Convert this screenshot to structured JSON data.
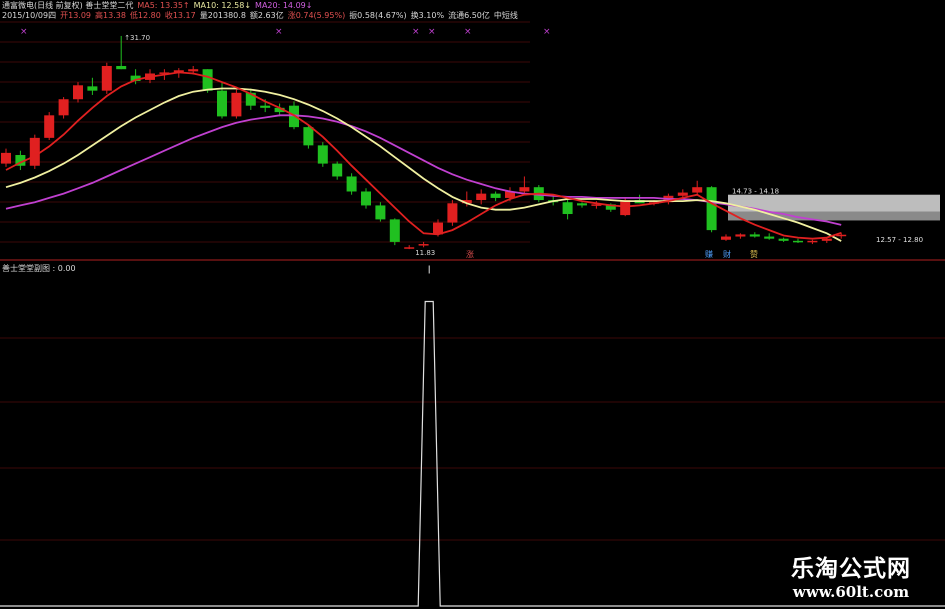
{
  "header": {
    "line1": [
      {
        "text": "通富微电(日线 前复权) 善士堂堂二代",
        "color": "#d8d8d8"
      },
      {
        "text": "MA5: 13.35↑",
        "color": "#e05050"
      },
      {
        "text": "MA10: 12.58↓",
        "color": "#e8e8a0"
      },
      {
        "text": "MA20: 14.09↓",
        "color": "#d060e0"
      }
    ],
    "line2": [
      {
        "text": "2015/10/09四",
        "color": "#d8d8d8"
      },
      {
        "text": "开13.09",
        "color": "#e05050"
      },
      {
        "text": "高13.38",
        "color": "#e05050"
      },
      {
        "text": "低12.80",
        "color": "#e05050"
      },
      {
        "text": "收13.17",
        "color": "#e05050"
      },
      {
        "text": "量201380.8",
        "color": "#d8d8d8"
      },
      {
        "text": "额2.63亿",
        "color": "#d8d8d8"
      },
      {
        "text": "涨0.74(5.95%)",
        "color": "#e05050"
      },
      {
        "text": "振0.58(4.67%)",
        "color": "#d8d8d8"
      },
      {
        "text": "换3.10%",
        "color": "#d8d8d8"
      },
      {
        "text": "流通6.50亿",
        "color": "#d8d8d8"
      },
      {
        "text": "中短线",
        "color": "#d8d8d8"
      }
    ]
  },
  "main": {
    "high_label": "31.70",
    "low_label": "11.83",
    "band_label_upper": "14.73 - 14.18",
    "band_label_lower": "12.57 - 12.80",
    "tags": [
      {
        "text": "涨",
        "color": "#e05050"
      },
      {
        "text": "赚",
        "color": "#50a0ff"
      },
      {
        "text": "财",
        "color": "#50a0ff"
      },
      {
        "text": "赞",
        "color": "#e0c050"
      }
    ],
    "colors": {
      "up": "#e02020",
      "down": "#20c020",
      "ma5": "#e02020",
      "ma10": "#f0f0a0",
      "ma20": "#c040d0",
      "grid": "#7a1010"
    }
  },
  "sub": {
    "title": "善士堂堂副图 : 0.00",
    "line_color": "#e0e0e0"
  },
  "watermark": {
    "title": "乐淘公式网",
    "url": "www.60lt.com"
  },
  "chart_data": {
    "type": "candlestick",
    "candles": [
      [
        19.8,
        21.2,
        19.5,
        20.8
      ],
      [
        20.6,
        21.0,
        19.2,
        19.6
      ],
      [
        19.6,
        22.5,
        19.3,
        22.2
      ],
      [
        22.2,
        24.6,
        22.0,
        24.3
      ],
      [
        24.3,
        26.0,
        24.0,
        25.8
      ],
      [
        25.8,
        27.4,
        25.5,
        27.1
      ],
      [
        27.0,
        27.8,
        26.2,
        26.6
      ],
      [
        26.6,
        29.2,
        26.3,
        28.9
      ],
      [
        28.9,
        31.7,
        28.6,
        28.6
      ],
      [
        28.0,
        28.6,
        27.2,
        27.5
      ],
      [
        27.6,
        28.6,
        27.3,
        28.2
      ],
      [
        28.2,
        28.6,
        27.6,
        28.3
      ],
      [
        28.3,
        28.7,
        27.8,
        28.5
      ],
      [
        28.4,
        28.9,
        28.1,
        28.6
      ],
      [
        28.6,
        28.6,
        26.4,
        26.6
      ],
      [
        26.6,
        27.4,
        24.0,
        24.2
      ],
      [
        24.2,
        26.7,
        24.0,
        26.4
      ],
      [
        26.4,
        26.8,
        24.8,
        25.2
      ],
      [
        25.2,
        25.8,
        24.6,
        25.0
      ],
      [
        25.0,
        25.4,
        24.2,
        24.6
      ],
      [
        25.2,
        25.6,
        23.0,
        23.2
      ],
      [
        23.2,
        23.4,
        21.2,
        21.5
      ],
      [
        21.5,
        21.8,
        19.5,
        19.8
      ],
      [
        19.8,
        20.0,
        18.3,
        18.6
      ],
      [
        18.6,
        18.9,
        16.9,
        17.2
      ],
      [
        17.2,
        17.5,
        15.6,
        15.9
      ],
      [
        15.9,
        16.2,
        14.4,
        14.6
      ],
      [
        14.6,
        14.7,
        12.2,
        12.5
      ],
      [
        12.0,
        12.2,
        11.83,
        12.0
      ],
      [
        12.2,
        12.5,
        12.0,
        12.3
      ],
      [
        13.2,
        14.6,
        13.0,
        14.3
      ],
      [
        14.3,
        16.4,
        14.0,
        16.1
      ],
      [
        16.1,
        17.2,
        15.8,
        16.4
      ],
      [
        16.4,
        17.4,
        16.0,
        17.0
      ],
      [
        17.0,
        17.2,
        16.3,
        16.6
      ],
      [
        16.6,
        17.6,
        16.3,
        17.2
      ],
      [
        17.2,
        18.6,
        17.0,
        17.6
      ],
      [
        17.6,
        17.8,
        16.2,
        16.4
      ],
      [
        16.4,
        16.9,
        15.9,
        16.2
      ],
      [
        16.2,
        16.6,
        14.6,
        15.1
      ],
      [
        16.1,
        16.2,
        15.7,
        15.9
      ],
      [
        15.9,
        16.3,
        15.6,
        16.0
      ],
      [
        16.0,
        16.1,
        15.3,
        15.5
      ],
      [
        15.0,
        16.6,
        14.9,
        16.4
      ],
      [
        16.4,
        16.9,
        16.1,
        16.1
      ],
      [
        16.2,
        16.4,
        15.9,
        16.2
      ],
      [
        16.2,
        17.0,
        16.0,
        16.8
      ],
      [
        16.8,
        17.4,
        16.5,
        17.1
      ],
      [
        17.1,
        18.2,
        16.9,
        17.6
      ],
      [
        17.6,
        17.7,
        13.4,
        13.6
      ],
      [
        12.7,
        13.2,
        12.6,
        13.0
      ],
      [
        13.0,
        13.3,
        12.8,
        13.2
      ],
      [
        13.2,
        13.4,
        12.9,
        13.0
      ],
      [
        13.0,
        13.3,
        12.7,
        12.8
      ],
      [
        12.8,
        12.9,
        12.5,
        12.6
      ],
      [
        12.6,
        12.8,
        12.4,
        12.5
      ],
      [
        12.5,
        12.7,
        12.3,
        12.6
      ],
      [
        12.6,
        12.9,
        12.4,
        12.8
      ],
      [
        13.09,
        13.38,
        12.8,
        13.17
      ]
    ],
    "ma5": [
      19.2,
      19.9,
      20.5,
      21.4,
      22.5,
      23.8,
      25.0,
      26.1,
      27.0,
      27.6,
      27.9,
      28.1,
      28.3,
      28.2,
      27.9,
      27.4,
      26.9,
      26.3,
      25.6,
      25.0,
      24.3,
      23.4,
      22.3,
      21.0,
      19.6,
      18.3,
      17.0,
      15.7,
      14.4,
      13.3,
      13.2,
      13.6,
      14.3,
      15.1,
      15.9,
      16.5,
      16.9,
      17.0,
      16.9,
      16.6,
      16.3,
      16.1,
      15.9,
      15.8,
      15.9,
      16.1,
      16.3,
      16.6,
      16.9,
      16.1,
      15.4,
      14.7,
      14.1,
      13.6,
      13.1,
      12.9,
      12.8,
      12.9,
      13.35
    ],
    "ma10": [
      17.6,
      18.0,
      18.5,
      19.1,
      19.8,
      20.6,
      21.5,
      22.4,
      23.3,
      24.1,
      24.8,
      25.5,
      26.1,
      26.5,
      26.7,
      26.8,
      26.8,
      26.7,
      26.5,
      26.2,
      25.8,
      25.3,
      24.7,
      24.0,
      23.2,
      22.3,
      21.4,
      20.4,
      19.4,
      18.4,
      17.5,
      16.7,
      16.1,
      15.7,
      15.5,
      15.5,
      15.7,
      16.0,
      16.3,
      16.5,
      16.5,
      16.5,
      16.4,
      16.3,
      16.3,
      16.3,
      16.3,
      16.3,
      16.4,
      16.3,
      16.1,
      15.8,
      15.5,
      15.1,
      14.7,
      14.3,
      13.8,
      13.3,
      12.58
    ],
    "ma20": [
      15.6,
      15.9,
      16.2,
      16.6,
      17.0,
      17.5,
      18.0,
      18.6,
      19.2,
      19.8,
      20.4,
      21.0,
      21.6,
      22.2,
      22.7,
      23.2,
      23.6,
      23.9,
      24.1,
      24.3,
      24.3,
      24.2,
      24.0,
      23.7,
      23.3,
      22.8,
      22.2,
      21.5,
      20.8,
      20.1,
      19.4,
      18.8,
      18.3,
      17.9,
      17.5,
      17.2,
      17.0,
      16.9,
      16.8,
      16.7,
      16.7,
      16.6,
      16.6,
      16.6,
      16.6,
      16.6,
      16.5,
      16.5,
      16.4,
      16.2,
      16.0,
      15.8,
      15.6,
      15.3,
      15.1,
      14.8,
      14.6,
      14.4,
      14.09
    ],
    "y_range": [
      11.0,
      33.0
    ],
    "sub_signal": {
      "index": 28,
      "value": 0.92
    },
    "sub_y_range": [
      0,
      1
    ]
  }
}
